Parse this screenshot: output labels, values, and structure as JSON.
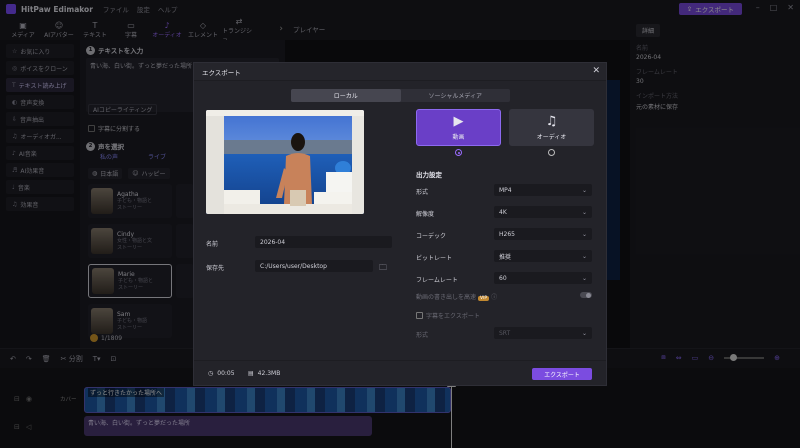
{
  "app": {
    "title": "HitPaw Edimakor",
    "menu": [
      "ファイル",
      "設定",
      "ヘルプ"
    ],
    "export_button": "エクスポート"
  },
  "toolbar": {
    "tabs": [
      {
        "label": "メディア",
        "icon": "media-icon"
      },
      {
        "label": "AIアバター",
        "icon": "ai-avatar-icon"
      },
      {
        "label": "テキスト",
        "icon": "text-icon"
      },
      {
        "label": "字幕",
        "icon": "subtitle-icon"
      },
      {
        "label": "オーディオ",
        "icon": "audio-icon"
      },
      {
        "label": "エレメント",
        "icon": "element-icon"
      },
      {
        "label": "トランジショ",
        "icon": "transition-icon"
      }
    ]
  },
  "sidebar": {
    "items": [
      {
        "label": "お気に入り",
        "icon": "star-icon"
      },
      {
        "label": "ボイスをクローン",
        "icon": "clone-icon"
      },
      {
        "label": "テキスト読み上げ",
        "icon": "tts-icon"
      },
      {
        "label": "音声変換",
        "icon": "voice-change-icon"
      },
      {
        "label": "音声抽出",
        "icon": "extract-icon"
      },
      {
        "label": "オーディオガ...",
        "icon": "audio-guide-icon"
      },
      {
        "label": "AI音楽",
        "icon": "ai-music-icon"
      },
      {
        "label": "AI効果音",
        "icon": "ai-sfx-icon"
      },
      {
        "label": "音楽",
        "icon": "music-icon"
      },
      {
        "label": "効果音",
        "icon": "sfx-icon"
      }
    ]
  },
  "tts": {
    "step1_title": "テキストを入力",
    "text_value": "青い海、白い街。ずっと夢だった場所",
    "ai_copy_button": "AIコピーライティング",
    "split_subtitle": "字幕に分割する",
    "step2_title": "声を選択",
    "tab_recommended": "私の声",
    "tab_library": "ライブ",
    "tab_ai": "AI",
    "lang": "日本語",
    "category": "ハッピー",
    "voices": [
      {
        "name": "Agatha",
        "desc1": "子ども・物語と",
        "desc2": "ストーリー"
      },
      {
        "name": "Cindy",
        "desc1": "女性・物語と文",
        "desc2": "ストーリー"
      },
      {
        "name": "Marie",
        "desc1": "子ども・物語と",
        "desc2": "ストーリー"
      },
      {
        "name": "Sam",
        "desc1": "子ども・物語",
        "desc2": "ストーリー"
      }
    ],
    "counter": "1/1809"
  },
  "player": {
    "label": "プレイヤー"
  },
  "right_panel": {
    "tab": "詳細",
    "name_label": "名前",
    "name_value": "2026-04",
    "framerate_label": "フレームレート",
    "framerate_value": "30",
    "import_label": "インポート方法",
    "import_value": "元の素材に保存"
  },
  "timeline": {
    "split_label": "分割",
    "video_clip_title": "ずっと行きたかった場所へ",
    "cover_label": "カバー",
    "audio_clip_title": "青い海、白い街。ずっと夢だった場所"
  },
  "export_dialog": {
    "title": "エクスポート",
    "tab_local": "ローカル",
    "tab_social": "ソーシャルメディア",
    "name_label": "名前",
    "name_value": "2026-04",
    "save_label": "保存先",
    "save_value": "C:/Users/user/Desktop",
    "video_label": "動画",
    "audio_label": "オーディオ",
    "output_settings": "出力設定",
    "settings": [
      {
        "label": "形式",
        "value": "MP4"
      },
      {
        "label": "解像度",
        "value": "4K"
      },
      {
        "label": "コーデック",
        "value": "H265"
      },
      {
        "label": "ビットレート",
        "value": "推奨"
      },
      {
        "label": "フレームレート",
        "value": "60"
      }
    ],
    "smart_match_label": "動画の書き出しを高速",
    "vip_badge": "VIP",
    "export_subtitle": "字幕をエクスポート",
    "subtitle_format_label": "形式",
    "subtitle_format_value": "SRT",
    "duration": "00:05",
    "size": "42.3MB",
    "export_button": "エクスポート"
  }
}
